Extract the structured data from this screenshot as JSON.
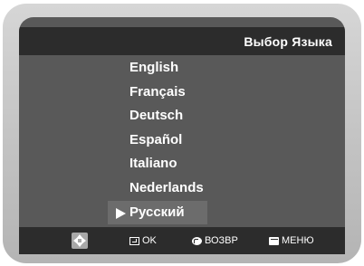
{
  "header": {
    "title": "Выбор Языка"
  },
  "languages": [
    {
      "label": "English",
      "selected": false
    },
    {
      "label": "Français",
      "selected": false
    },
    {
      "label": "Deutsch",
      "selected": false
    },
    {
      "label": "Español",
      "selected": false
    },
    {
      "label": "Italiano",
      "selected": false
    },
    {
      "label": "Nederlands",
      "selected": false
    },
    {
      "label": "Русский",
      "selected": true
    }
  ],
  "footer": {
    "navigate_icon": "dpad-icon",
    "ok_label": "OK",
    "ok_icon": "enter-icon",
    "return_label": "ВОЗВР",
    "return_icon": "return-icon",
    "menu_label": "МЕНЮ",
    "menu_icon": "menu-icon"
  },
  "colors": {
    "screen_bg": "#595959",
    "bar_bg": "#2c2c2c",
    "highlight_bg": "#6c6c6c",
    "text": "#ffffff",
    "bezel": "#c8c8c8"
  }
}
